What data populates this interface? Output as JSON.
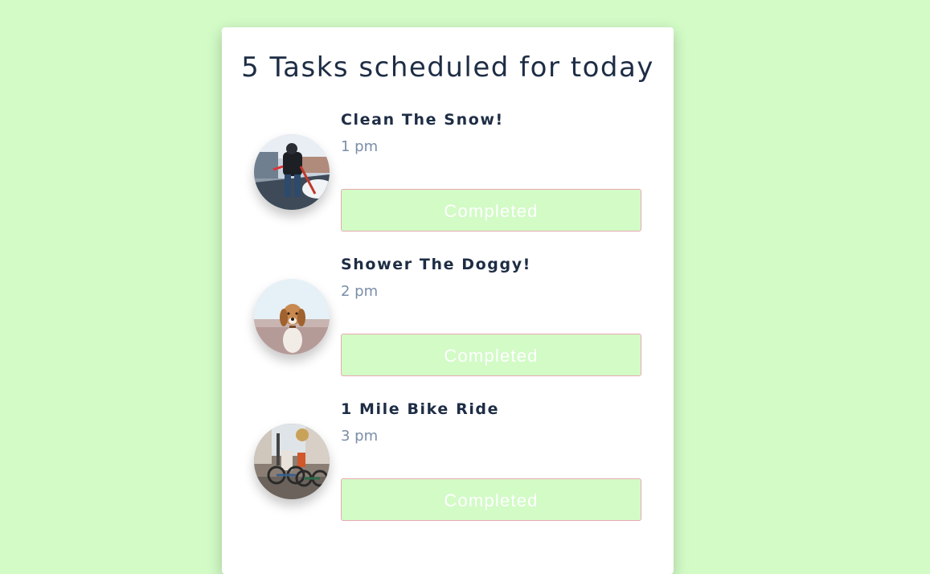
{
  "page": {
    "background": "#d2fbc6"
  },
  "card": {
    "title": "5 Tasks scheduled for today"
  },
  "tasks": [
    {
      "name": "Clean The Snow!",
      "time": "1 pm",
      "button_label": "Completed",
      "image": "snow-shoveling-photo"
    },
    {
      "name": "Shower The Doggy!",
      "time": "2 pm",
      "button_label": "Completed",
      "image": "dog-photo"
    },
    {
      "name": "1 Mile Bike Ride",
      "time": "3 pm",
      "button_label": "Completed",
      "image": "bike-ride-photo"
    }
  ],
  "colors": {
    "accent_green": "#d2fbc6",
    "button_border": "#e8a9b4",
    "title_text": "#1e2d45",
    "time_text": "#7a8ea8"
  }
}
